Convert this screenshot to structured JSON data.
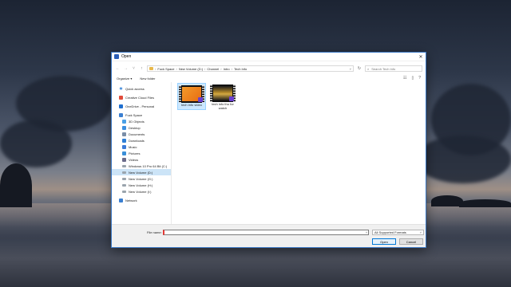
{
  "window": {
    "title": "Open"
  },
  "address": {
    "breadcrumbs": [
      "Fuck Space",
      "New Volume (D:)",
      "Channel",
      "Intro",
      "Tech Info"
    ],
    "search_placeholder": "Search Tech Info"
  },
  "toolbar": {
    "organize_label": "Organize ▾",
    "new_folder_label": "New folder"
  },
  "sidebar": {
    "items": [
      {
        "label": "Quick access",
        "icon": "star-icon"
      },
      {
        "label": "Creative Cloud Files",
        "icon": "creative-cloud-icon"
      },
      {
        "label": "OneDrive - Personal",
        "icon": "onedrive-icon"
      },
      {
        "label": "Fuck Space",
        "icon": "computer-icon"
      },
      {
        "label": "3D Objects",
        "icon": "3d-objects-icon"
      },
      {
        "label": "Desktop",
        "icon": "desktop-icon"
      },
      {
        "label": "Documents",
        "icon": "documents-icon"
      },
      {
        "label": "Downloads",
        "icon": "downloads-icon"
      },
      {
        "label": "Music",
        "icon": "music-icon"
      },
      {
        "label": "Pictures",
        "icon": "pictures-icon"
      },
      {
        "label": "Videos",
        "icon": "videos-icon"
      },
      {
        "label": "Windows 10 Pro 64 Bit (C:)",
        "icon": "drive-icon"
      },
      {
        "label": "New Volume (D:)",
        "icon": "drive-icon"
      },
      {
        "label": "New Volume (G:)",
        "icon": "drive-icon"
      },
      {
        "label": "New Volume (H:)",
        "icon": "drive-icon"
      },
      {
        "label": "New Volume (I:)",
        "icon": "drive-icon"
      },
      {
        "label": "Network",
        "icon": "network-icon"
      }
    ]
  },
  "files": [
    {
      "name": "tech info video"
    },
    {
      "name": "tech info thu for watch"
    }
  ],
  "bottom": {
    "file_name_label": "File name:",
    "file_name_value": "",
    "file_type": "All Supported Formats",
    "open_label": "Open",
    "cancel_label": "Cancel"
  },
  "colors": {
    "accent": "#0078d7",
    "selection": "#cce8ff",
    "title_border": "#3b78c4"
  }
}
